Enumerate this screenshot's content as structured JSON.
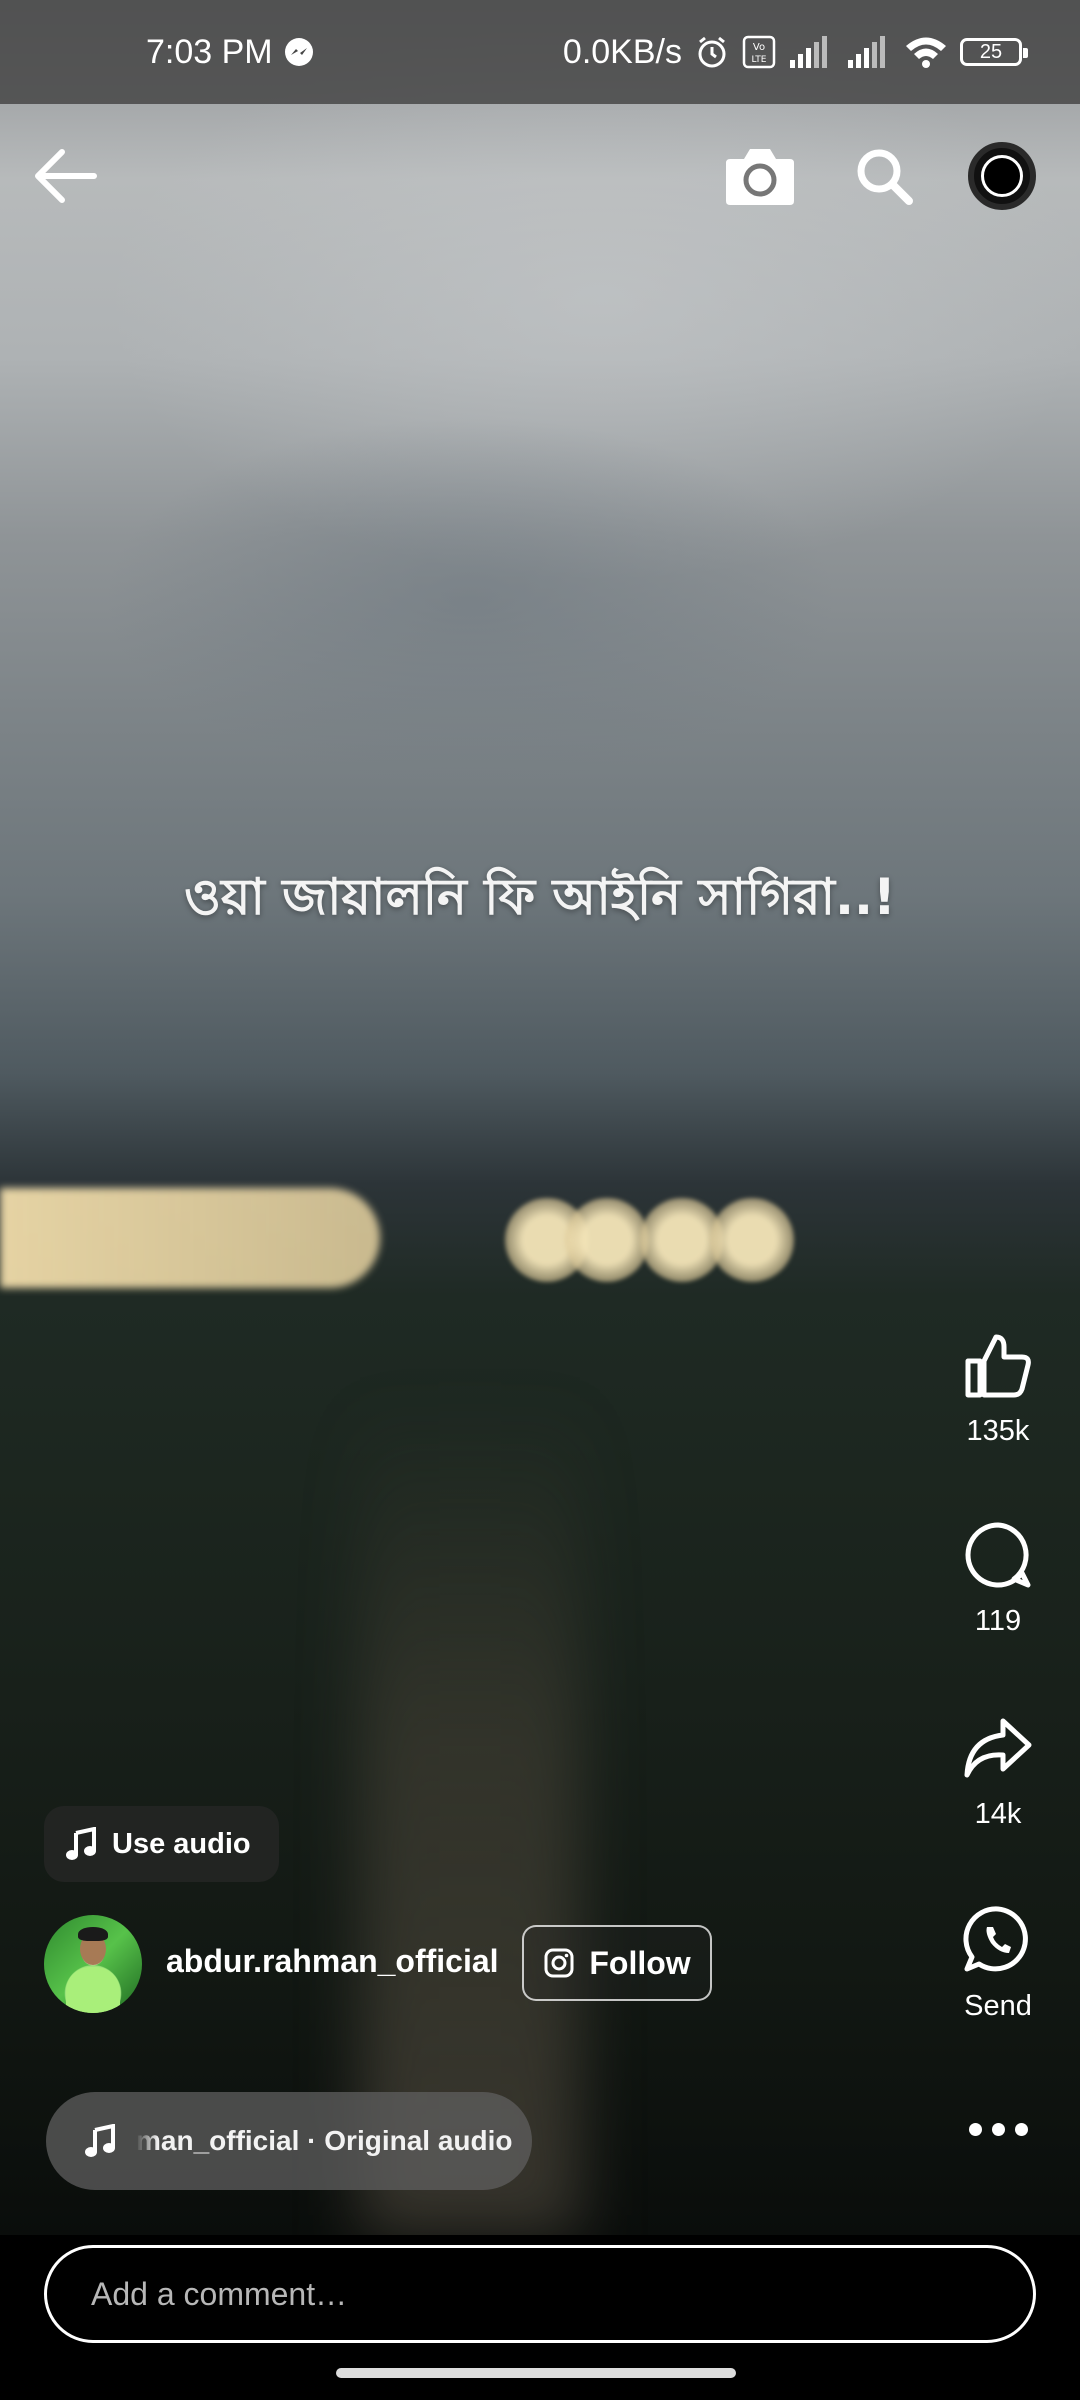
{
  "status_bar": {
    "time": "7:03 PM",
    "net_speed": "0.0KB/s",
    "battery": "25",
    "icons": [
      "messenger-icon",
      "alarm-icon",
      "volte-icon",
      "signal-icon",
      "signal-icon",
      "wifi-icon",
      "battery-icon"
    ]
  },
  "top_nav": {
    "icons": [
      "back-arrow-icon",
      "camera-icon",
      "search-icon",
      "profile-icon"
    ]
  },
  "video": {
    "caption": "ওয়া জায়ালনি ফি আইনি সাগিরা..!"
  },
  "actions": {
    "like_count": "135k",
    "comment_count": "119",
    "share_count": "14k",
    "send_label": "Send"
  },
  "audio": {
    "use_audio_label": "Use audio",
    "track_text": "man_official · Original audio"
  },
  "author": {
    "username": "abdur.rahman_official",
    "follow_label": "Follow"
  },
  "comment_bar": {
    "placeholder": "Add a comment…"
  },
  "colors": {
    "text": "#ffffff",
    "bar_bg": "#000000",
    "pill_bg": "#5f5f5f"
  }
}
